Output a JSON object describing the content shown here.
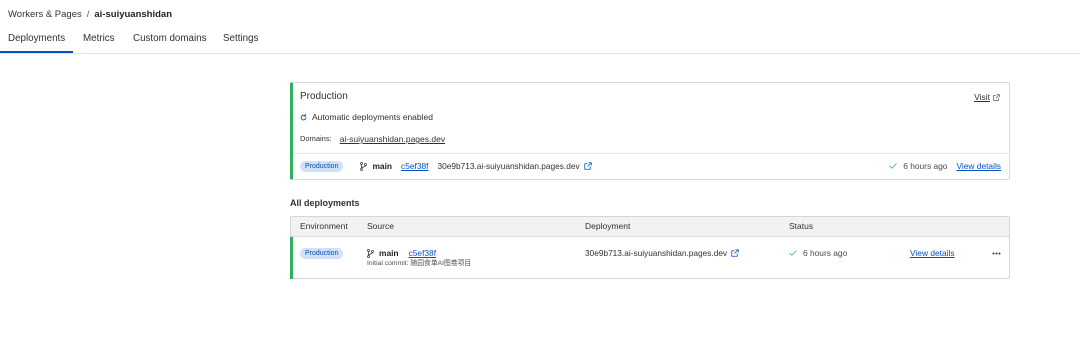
{
  "breadcrumb": {
    "parent": "Workers & Pages",
    "separator": "/",
    "current": "ai-suiyuanshidan"
  },
  "tabs": [
    {
      "label": "Deployments",
      "active": true
    },
    {
      "label": "Metrics",
      "active": false
    },
    {
      "label": "Custom domains",
      "active": false
    },
    {
      "label": "Settings",
      "active": false
    }
  ],
  "production": {
    "title": "Production",
    "visit_label": "Visit",
    "auto_deploy_text": "Automatic deployments enabled",
    "domains_label": "Domains:",
    "domain": "ai-suiyuanshidan.pages.dev",
    "environment_badge": "Production",
    "branch": "main",
    "commit": "c5ef38f",
    "deployment_url": "30e9b713.ai-suiyuanshidan.pages.dev",
    "status_time": "6 hours ago",
    "view_details_label": "View details"
  },
  "all_deployments": {
    "heading": "All deployments",
    "columns": [
      "Environment",
      "Source",
      "Deployment",
      "Status"
    ],
    "rows": [
      {
        "environment": "Production",
        "branch": "main",
        "commit": "c5ef38f",
        "commit_message": "Initial commit: 随园食单AI图卷项目",
        "deployment_url": "30e9b713.ai-suiyuanshidan.pages.dev",
        "status_time": "6 hours ago",
        "view_details_label": "View details"
      }
    ]
  },
  "icons": {
    "visit": "external-link-icon",
    "auto_deploy": "refresh-icon",
    "branch": "git-branch-icon",
    "deployment_link": "external-link-icon",
    "status": "check-icon",
    "row_menu": "more-horizontal-icon"
  },
  "colors": {
    "accent": "#0051c3",
    "success": "#2db35e",
    "badge_background": "#cfe1fb",
    "badge_text": "#0b4ea2",
    "text": "#313131",
    "border": "#d9d9d9",
    "table_header_background": "#f2f2f2"
  }
}
